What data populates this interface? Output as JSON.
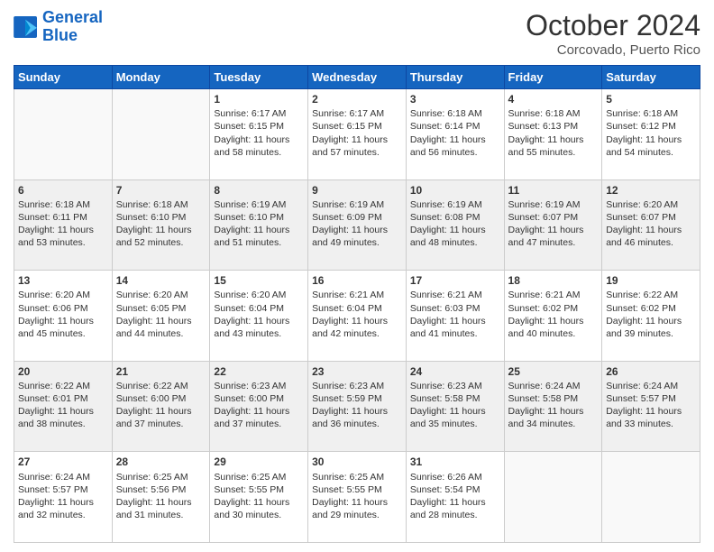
{
  "header": {
    "logo_line1": "General",
    "logo_line2": "Blue",
    "month_title": "October 2024",
    "location": "Corcovado, Puerto Rico"
  },
  "weekdays": [
    "Sunday",
    "Monday",
    "Tuesday",
    "Wednesday",
    "Thursday",
    "Friday",
    "Saturday"
  ],
  "weeks": [
    [
      {
        "day": "",
        "sunrise": "",
        "sunset": "",
        "daylight": ""
      },
      {
        "day": "",
        "sunrise": "",
        "sunset": "",
        "daylight": ""
      },
      {
        "day": "1",
        "sunrise": "Sunrise: 6:17 AM",
        "sunset": "Sunset: 6:15 PM",
        "daylight": "Daylight: 11 hours and 58 minutes."
      },
      {
        "day": "2",
        "sunrise": "Sunrise: 6:17 AM",
        "sunset": "Sunset: 6:15 PM",
        "daylight": "Daylight: 11 hours and 57 minutes."
      },
      {
        "day": "3",
        "sunrise": "Sunrise: 6:18 AM",
        "sunset": "Sunset: 6:14 PM",
        "daylight": "Daylight: 11 hours and 56 minutes."
      },
      {
        "day": "4",
        "sunrise": "Sunrise: 6:18 AM",
        "sunset": "Sunset: 6:13 PM",
        "daylight": "Daylight: 11 hours and 55 minutes."
      },
      {
        "day": "5",
        "sunrise": "Sunrise: 6:18 AM",
        "sunset": "Sunset: 6:12 PM",
        "daylight": "Daylight: 11 hours and 54 minutes."
      }
    ],
    [
      {
        "day": "6",
        "sunrise": "Sunrise: 6:18 AM",
        "sunset": "Sunset: 6:11 PM",
        "daylight": "Daylight: 11 hours and 53 minutes."
      },
      {
        "day": "7",
        "sunrise": "Sunrise: 6:18 AM",
        "sunset": "Sunset: 6:10 PM",
        "daylight": "Daylight: 11 hours and 52 minutes."
      },
      {
        "day": "8",
        "sunrise": "Sunrise: 6:19 AM",
        "sunset": "Sunset: 6:10 PM",
        "daylight": "Daylight: 11 hours and 51 minutes."
      },
      {
        "day": "9",
        "sunrise": "Sunrise: 6:19 AM",
        "sunset": "Sunset: 6:09 PM",
        "daylight": "Daylight: 11 hours and 49 minutes."
      },
      {
        "day": "10",
        "sunrise": "Sunrise: 6:19 AM",
        "sunset": "Sunset: 6:08 PM",
        "daylight": "Daylight: 11 hours and 48 minutes."
      },
      {
        "day": "11",
        "sunrise": "Sunrise: 6:19 AM",
        "sunset": "Sunset: 6:07 PM",
        "daylight": "Daylight: 11 hours and 47 minutes."
      },
      {
        "day": "12",
        "sunrise": "Sunrise: 6:20 AM",
        "sunset": "Sunset: 6:07 PM",
        "daylight": "Daylight: 11 hours and 46 minutes."
      }
    ],
    [
      {
        "day": "13",
        "sunrise": "Sunrise: 6:20 AM",
        "sunset": "Sunset: 6:06 PM",
        "daylight": "Daylight: 11 hours and 45 minutes."
      },
      {
        "day": "14",
        "sunrise": "Sunrise: 6:20 AM",
        "sunset": "Sunset: 6:05 PM",
        "daylight": "Daylight: 11 hours and 44 minutes."
      },
      {
        "day": "15",
        "sunrise": "Sunrise: 6:20 AM",
        "sunset": "Sunset: 6:04 PM",
        "daylight": "Daylight: 11 hours and 43 minutes."
      },
      {
        "day": "16",
        "sunrise": "Sunrise: 6:21 AM",
        "sunset": "Sunset: 6:04 PM",
        "daylight": "Daylight: 11 hours and 42 minutes."
      },
      {
        "day": "17",
        "sunrise": "Sunrise: 6:21 AM",
        "sunset": "Sunset: 6:03 PM",
        "daylight": "Daylight: 11 hours and 41 minutes."
      },
      {
        "day": "18",
        "sunrise": "Sunrise: 6:21 AM",
        "sunset": "Sunset: 6:02 PM",
        "daylight": "Daylight: 11 hours and 40 minutes."
      },
      {
        "day": "19",
        "sunrise": "Sunrise: 6:22 AM",
        "sunset": "Sunset: 6:02 PM",
        "daylight": "Daylight: 11 hours and 39 minutes."
      }
    ],
    [
      {
        "day": "20",
        "sunrise": "Sunrise: 6:22 AM",
        "sunset": "Sunset: 6:01 PM",
        "daylight": "Daylight: 11 hours and 38 minutes."
      },
      {
        "day": "21",
        "sunrise": "Sunrise: 6:22 AM",
        "sunset": "Sunset: 6:00 PM",
        "daylight": "Daylight: 11 hours and 37 minutes."
      },
      {
        "day": "22",
        "sunrise": "Sunrise: 6:23 AM",
        "sunset": "Sunset: 6:00 PM",
        "daylight": "Daylight: 11 hours and 37 minutes."
      },
      {
        "day": "23",
        "sunrise": "Sunrise: 6:23 AM",
        "sunset": "Sunset: 5:59 PM",
        "daylight": "Daylight: 11 hours and 36 minutes."
      },
      {
        "day": "24",
        "sunrise": "Sunrise: 6:23 AM",
        "sunset": "Sunset: 5:58 PM",
        "daylight": "Daylight: 11 hours and 35 minutes."
      },
      {
        "day": "25",
        "sunrise": "Sunrise: 6:24 AM",
        "sunset": "Sunset: 5:58 PM",
        "daylight": "Daylight: 11 hours and 34 minutes."
      },
      {
        "day": "26",
        "sunrise": "Sunrise: 6:24 AM",
        "sunset": "Sunset: 5:57 PM",
        "daylight": "Daylight: 11 hours and 33 minutes."
      }
    ],
    [
      {
        "day": "27",
        "sunrise": "Sunrise: 6:24 AM",
        "sunset": "Sunset: 5:57 PM",
        "daylight": "Daylight: 11 hours and 32 minutes."
      },
      {
        "day": "28",
        "sunrise": "Sunrise: 6:25 AM",
        "sunset": "Sunset: 5:56 PM",
        "daylight": "Daylight: 11 hours and 31 minutes."
      },
      {
        "day": "29",
        "sunrise": "Sunrise: 6:25 AM",
        "sunset": "Sunset: 5:55 PM",
        "daylight": "Daylight: 11 hours and 30 minutes."
      },
      {
        "day": "30",
        "sunrise": "Sunrise: 6:25 AM",
        "sunset": "Sunset: 5:55 PM",
        "daylight": "Daylight: 11 hours and 29 minutes."
      },
      {
        "day": "31",
        "sunrise": "Sunrise: 6:26 AM",
        "sunset": "Sunset: 5:54 PM",
        "daylight": "Daylight: 11 hours and 28 minutes."
      },
      {
        "day": "",
        "sunrise": "",
        "sunset": "",
        "daylight": ""
      },
      {
        "day": "",
        "sunrise": "",
        "sunset": "",
        "daylight": ""
      }
    ]
  ]
}
